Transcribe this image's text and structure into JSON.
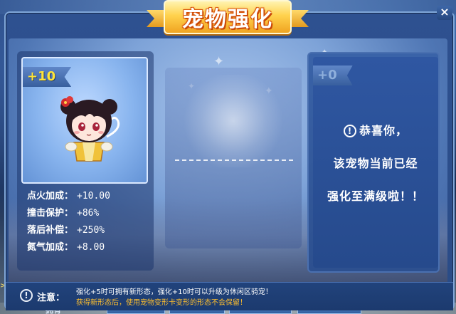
{
  "background": {
    "bottom_button_label": "拥有",
    "left_tag": ">>"
  },
  "dialog": {
    "title": "宠物强化",
    "close_label": "×"
  },
  "pet_card": {
    "level": "+10",
    "stats": [
      {
        "label": "点火加成：",
        "value": "+10.00"
      },
      {
        "label": "撞击保护：",
        "value": "+86%"
      },
      {
        "label": "落后补偿：",
        "value": "+250%"
      },
      {
        "label": "氮气加成：",
        "value": "+8.00"
      }
    ]
  },
  "result_card": {
    "level": "+0",
    "message_line1": "恭喜你，",
    "message_line2": "该宠物当前已经",
    "message_line3": "强化至满级啦！！"
  },
  "notice": {
    "label": "注意：",
    "line1": "强化+5时可拥有新形态，强化+10时可以升级为休闲区骑宠！",
    "line2": "获得新形态后，使用宠物变形卡变形的形态不会保留！"
  },
  "colors": {
    "title_gold": "#ffd24d",
    "level_yellow": "#ffe438",
    "warning_orange": "#ffbf2e",
    "panel_blue": "#2d508f"
  }
}
